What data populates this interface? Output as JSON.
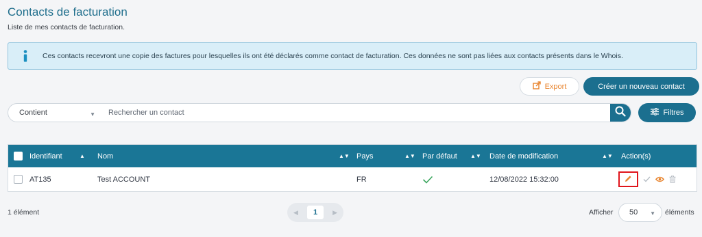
{
  "header": {
    "title": "Contacts de facturation",
    "subtitle": "Liste de mes contacts de facturation."
  },
  "info": {
    "text": "Ces contacts recevront une copie des factures pour lesquelles ils ont été déclarés comme contact de facturation. Ces données ne sont pas liées aux contacts présents dans le Whois."
  },
  "toolbar": {
    "export_label": "Export",
    "create_label": "Créer un nouveau contact",
    "filters_label": "Filtres"
  },
  "search": {
    "mode": "Contient",
    "placeholder": "Rechercher un contact"
  },
  "table": {
    "columns": [
      "Identifiant",
      "Nom",
      "Pays",
      "Par défaut",
      "Date de modification",
      "Action(s)"
    ],
    "rows": [
      {
        "identifiant": "AT135",
        "nom": "Test ACCOUNT",
        "pays": "FR",
        "par_defaut": true,
        "date": "12/08/2022 15:32:00"
      }
    ]
  },
  "footer": {
    "count": "1 élément",
    "current_page": "1",
    "per_page_label": "Afficher",
    "per_page_value": "50",
    "per_page_suffix": "éléments"
  },
  "colors": {
    "primary": "#1b6f8f",
    "header_bg": "#1a7696",
    "accent_orange": "#e8842e",
    "success_green": "#3aa55d",
    "highlight_red": "#e0141b"
  },
  "icons": [
    "info-icon",
    "export-icon",
    "search-icon",
    "filters-icon",
    "sort-icon",
    "check-icon",
    "edit-icon",
    "validate-icon",
    "view-icon",
    "delete-icon"
  ]
}
